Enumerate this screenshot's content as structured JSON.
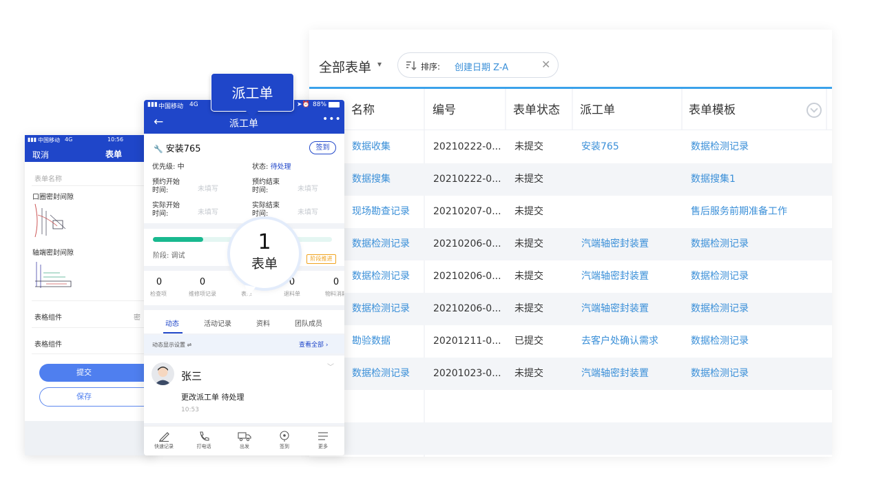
{
  "table": {
    "title": "全部表单",
    "sort_label": "排序:",
    "sort_value": "创建日期 Z-A",
    "columns": [
      "名称",
      "编号",
      "表单状态",
      "派工单",
      "表单模板"
    ],
    "rows": [
      [
        "数据收集",
        "20210222-0...",
        "未提交",
        "安装765",
        "数据检测记录"
      ],
      [
        "数据搜集",
        "20210222-0...",
        "未提交",
        "",
        "数据搜集1"
      ],
      [
        "现场勘查记录",
        "20210207-0...",
        "未提交",
        "",
        "售后服务前期准备工作"
      ],
      [
        "数据检测记录",
        "20210206-0...",
        "未提交",
        "汽端轴密封装置",
        "数据检测记录"
      ],
      [
        "数据检测记录",
        "20210206-0...",
        "未提交",
        "汽端轴密封装置",
        "数据检测记录"
      ],
      [
        "数据检测记录",
        "20210206-0...",
        "未提交",
        "汽端轴密封装置",
        "数据检测记录"
      ],
      [
        "勘验数据",
        "20201211-0...",
        "已提交",
        "去客户处确认需求",
        "数据检测记录"
      ],
      [
        "数据检测记录",
        "20201023-0...",
        "未提交",
        "汽端轴密封装置",
        "数据检测记录"
      ]
    ]
  },
  "left_phone": {
    "carrier": "中国移动",
    "network": "4G",
    "time": "10:56",
    "cancel": "取消",
    "title": "表单",
    "placeholder": "表单名称",
    "field1": "口圈密封间隙",
    "field2": "轴端密封间隙",
    "row1": "表格组件",
    "row1_extra": "密",
    "row2": "表格组件",
    "submit": "提交",
    "save": "保存"
  },
  "mid_phone": {
    "carrier": "中国移动",
    "network": "4G",
    "battery": "88%",
    "title": "派工单",
    "task": "安装765",
    "sign": "签到",
    "priority_label": "优先级:",
    "priority": "中",
    "status_label": "状态:",
    "status": "待处理",
    "plan_start_1": "预约开始",
    "plan_start_2": "时间:",
    "plan_end_1": "预约结束",
    "plan_end_2": "时间:",
    "act_start_1": "实际开始",
    "act_start_2": "时间:",
    "act_end_1": "实际结束",
    "act_end_2": "时间:",
    "unfilled": "未填写",
    "progress": 0.28,
    "stage_label": "阶段: 调试",
    "stage_btn": "阶段推进",
    "stats": [
      {
        "num": "0",
        "label": "检查项"
      },
      {
        "num": "0",
        "label": "维修项记录"
      },
      {
        "num": "",
        "label": "表单"
      },
      {
        "num": "0",
        "label": "退料单"
      },
      {
        "num": "0",
        "label": "物料消耗"
      }
    ],
    "tabs": [
      "动态",
      "活动记录",
      "资料",
      "团队成员"
    ],
    "filter_label": "动态显示设置",
    "view_all": "查看全部",
    "user": "张三",
    "activity": "更改派工单 待处理",
    "activity_time": "10:53",
    "bottom": [
      "快速记录",
      "打电话",
      "出发",
      "签到",
      "更多"
    ]
  },
  "callouts": {
    "badge": "派工单",
    "bubble_num": "1",
    "bubble_label": "表单"
  },
  "colors": {
    "brand_blue": "#1f46c9",
    "link_blue": "#3a8fd8",
    "accent_line": "#3aa1ea",
    "progress_green": "#19b98f",
    "warning_orange": "#f0a21d"
  }
}
